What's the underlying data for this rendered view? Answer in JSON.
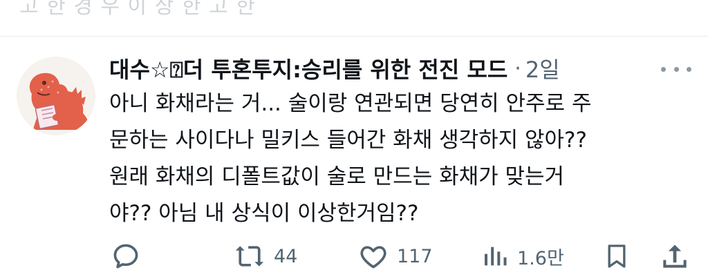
{
  "previous_tweet": {
    "text": "고 한 경 우 이 상 한 고 한"
  },
  "tweet": {
    "author": {
      "display_name": "대수☆⍰더 투혼투지:승리를 위한 전진 모드"
    },
    "separator": "·",
    "timestamp": "2일",
    "text_lines": [
      "아니 화채라는 거... 술이랑 연관되면 당연히 안주로 주",
      "문하는 사이다나 밀키스 들어간 화채 생각하지 않아??",
      "원래 화채의 디폴트값이 술로 만드는 화채가 맞는거",
      "야?? 아님 내 상식이 이상한거임??"
    ],
    "actions": {
      "reply": {
        "icon": "reply-icon",
        "count": ""
      },
      "retweet": {
        "icon": "retweet-icon",
        "count": "44"
      },
      "like": {
        "icon": "heart-icon",
        "count": "117"
      },
      "views": {
        "icon": "views-icon",
        "count": "1.6만"
      },
      "bookmark": {
        "icon": "bookmark-icon"
      },
      "share": {
        "icon": "share-icon"
      }
    }
  },
  "colors": {
    "text_primary": "#0f1419",
    "text_secondary": "#536471",
    "divider": "#e7ebee"
  }
}
